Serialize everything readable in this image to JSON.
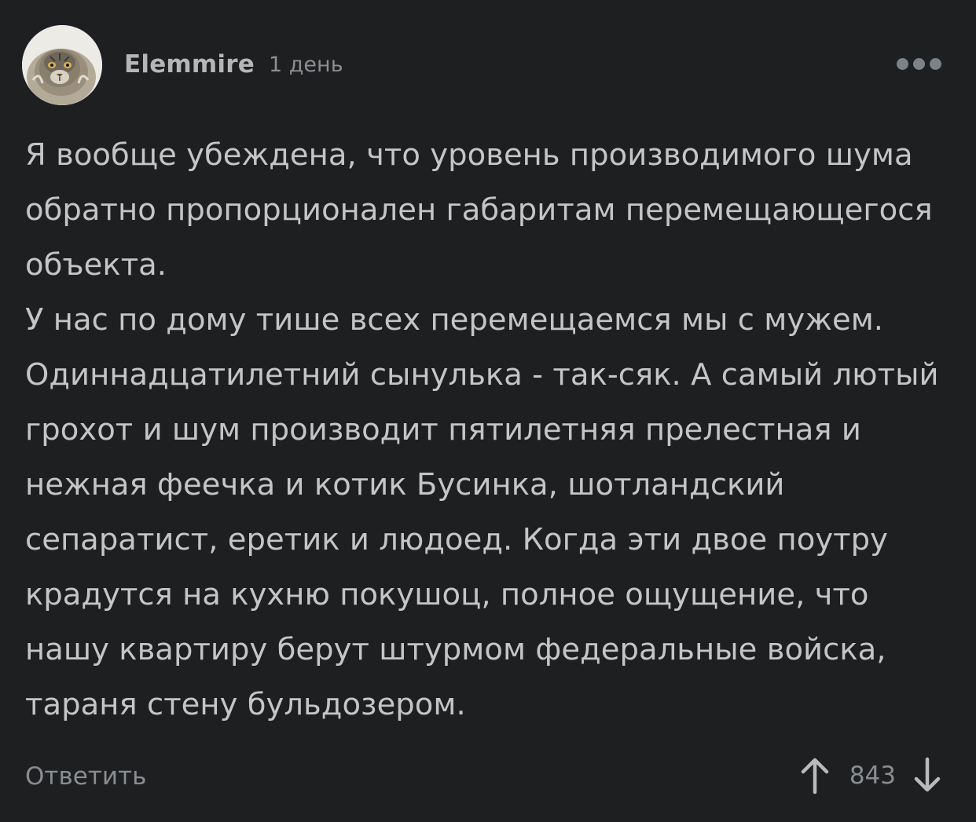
{
  "comment": {
    "author": "Elemmire",
    "date": "1 день",
    "paragraphs": [
      "Я вообще убеждена, что уровень производимого шума\nобратно пропорционален габаритам перемещающегося\nобъекта.",
      "У нас по дому тише всех перемещаемся мы с мужем.\nОдиннадцатилетний сынулька - так-сяк. А самый лютый\nгрохот и шум производит пятилетняя прелестная и\nнежная феечка и котик Бусинка, шотландский\nсепаратист, еретик и людоед. Когда эти двое поутру\nкрадутся на кухню покушоц, полное ощущение, что\nнашу квартиру берут штурмом федеральные войска,\nтараня стену бульдозером."
    ],
    "reply_label": "Ответить",
    "rating": "843"
  },
  "icons": {
    "more": "more-dots-icon",
    "upvote": "arrow-up-icon",
    "downvote": "arrow-down-icon"
  },
  "colors": {
    "background": "#1d1f21",
    "text": "#c3c5c7",
    "muted": "#8a8d90"
  }
}
